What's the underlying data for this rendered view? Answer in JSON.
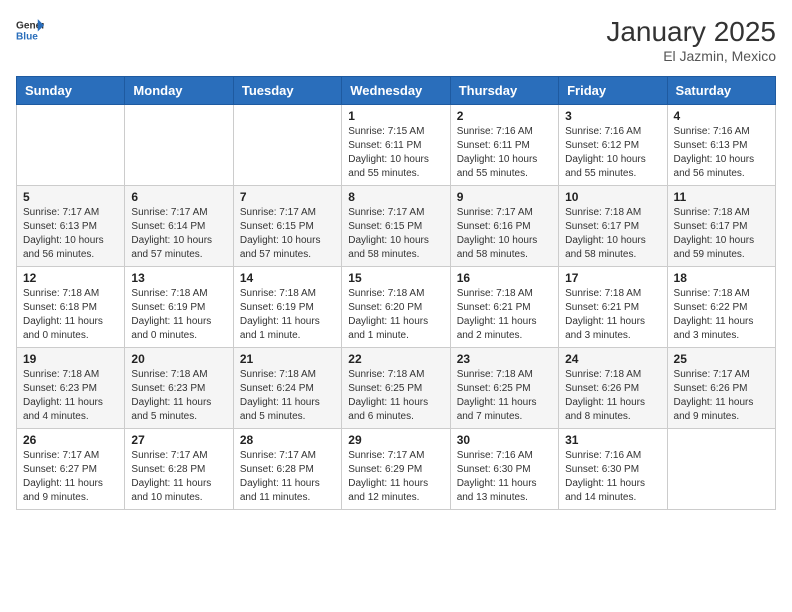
{
  "header": {
    "logo_general": "General",
    "logo_blue": "Blue",
    "month_year": "January 2025",
    "location": "El Jazmin, Mexico"
  },
  "days_of_week": [
    "Sunday",
    "Monday",
    "Tuesday",
    "Wednesday",
    "Thursday",
    "Friday",
    "Saturday"
  ],
  "weeks": [
    [
      {
        "day": "",
        "sunrise": "",
        "sunset": "",
        "daylight": ""
      },
      {
        "day": "",
        "sunrise": "",
        "sunset": "",
        "daylight": ""
      },
      {
        "day": "",
        "sunrise": "",
        "sunset": "",
        "daylight": ""
      },
      {
        "day": "1",
        "sunrise": "7:15 AM",
        "sunset": "6:11 PM",
        "daylight": "10 hours and 55 minutes."
      },
      {
        "day": "2",
        "sunrise": "7:16 AM",
        "sunset": "6:11 PM",
        "daylight": "10 hours and 55 minutes."
      },
      {
        "day": "3",
        "sunrise": "7:16 AM",
        "sunset": "6:12 PM",
        "daylight": "10 hours and 55 minutes."
      },
      {
        "day": "4",
        "sunrise": "7:16 AM",
        "sunset": "6:13 PM",
        "daylight": "10 hours and 56 minutes."
      }
    ],
    [
      {
        "day": "5",
        "sunrise": "7:17 AM",
        "sunset": "6:13 PM",
        "daylight": "10 hours and 56 minutes."
      },
      {
        "day": "6",
        "sunrise": "7:17 AM",
        "sunset": "6:14 PM",
        "daylight": "10 hours and 57 minutes."
      },
      {
        "day": "7",
        "sunrise": "7:17 AM",
        "sunset": "6:15 PM",
        "daylight": "10 hours and 57 minutes."
      },
      {
        "day": "8",
        "sunrise": "7:17 AM",
        "sunset": "6:15 PM",
        "daylight": "10 hours and 58 minutes."
      },
      {
        "day": "9",
        "sunrise": "7:17 AM",
        "sunset": "6:16 PM",
        "daylight": "10 hours and 58 minutes."
      },
      {
        "day": "10",
        "sunrise": "7:18 AM",
        "sunset": "6:17 PM",
        "daylight": "10 hours and 58 minutes."
      },
      {
        "day": "11",
        "sunrise": "7:18 AM",
        "sunset": "6:17 PM",
        "daylight": "10 hours and 59 minutes."
      }
    ],
    [
      {
        "day": "12",
        "sunrise": "7:18 AM",
        "sunset": "6:18 PM",
        "daylight": "11 hours and 0 minutes."
      },
      {
        "day": "13",
        "sunrise": "7:18 AM",
        "sunset": "6:19 PM",
        "daylight": "11 hours and 0 minutes."
      },
      {
        "day": "14",
        "sunrise": "7:18 AM",
        "sunset": "6:19 PM",
        "daylight": "11 hours and 1 minute."
      },
      {
        "day": "15",
        "sunrise": "7:18 AM",
        "sunset": "6:20 PM",
        "daylight": "11 hours and 1 minute."
      },
      {
        "day": "16",
        "sunrise": "7:18 AM",
        "sunset": "6:21 PM",
        "daylight": "11 hours and 2 minutes."
      },
      {
        "day": "17",
        "sunrise": "7:18 AM",
        "sunset": "6:21 PM",
        "daylight": "11 hours and 3 minutes."
      },
      {
        "day": "18",
        "sunrise": "7:18 AM",
        "sunset": "6:22 PM",
        "daylight": "11 hours and 3 minutes."
      }
    ],
    [
      {
        "day": "19",
        "sunrise": "7:18 AM",
        "sunset": "6:23 PM",
        "daylight": "11 hours and 4 minutes."
      },
      {
        "day": "20",
        "sunrise": "7:18 AM",
        "sunset": "6:23 PM",
        "daylight": "11 hours and 5 minutes."
      },
      {
        "day": "21",
        "sunrise": "7:18 AM",
        "sunset": "6:24 PM",
        "daylight": "11 hours and 5 minutes."
      },
      {
        "day": "22",
        "sunrise": "7:18 AM",
        "sunset": "6:25 PM",
        "daylight": "11 hours and 6 minutes."
      },
      {
        "day": "23",
        "sunrise": "7:18 AM",
        "sunset": "6:25 PM",
        "daylight": "11 hours and 7 minutes."
      },
      {
        "day": "24",
        "sunrise": "7:18 AM",
        "sunset": "6:26 PM",
        "daylight": "11 hours and 8 minutes."
      },
      {
        "day": "25",
        "sunrise": "7:17 AM",
        "sunset": "6:26 PM",
        "daylight": "11 hours and 9 minutes."
      }
    ],
    [
      {
        "day": "26",
        "sunrise": "7:17 AM",
        "sunset": "6:27 PM",
        "daylight": "11 hours and 9 minutes."
      },
      {
        "day": "27",
        "sunrise": "7:17 AM",
        "sunset": "6:28 PM",
        "daylight": "11 hours and 10 minutes."
      },
      {
        "day": "28",
        "sunrise": "7:17 AM",
        "sunset": "6:28 PM",
        "daylight": "11 hours and 11 minutes."
      },
      {
        "day": "29",
        "sunrise": "7:17 AM",
        "sunset": "6:29 PM",
        "daylight": "11 hours and 12 minutes."
      },
      {
        "day": "30",
        "sunrise": "7:16 AM",
        "sunset": "6:30 PM",
        "daylight": "11 hours and 13 minutes."
      },
      {
        "day": "31",
        "sunrise": "7:16 AM",
        "sunset": "6:30 PM",
        "daylight": "11 hours and 14 minutes."
      },
      {
        "day": "",
        "sunrise": "",
        "sunset": "",
        "daylight": ""
      }
    ]
  ],
  "labels": {
    "sunrise_prefix": "Sunrise: ",
    "sunset_prefix": "Sunset: ",
    "daylight_prefix": "Daylight: "
  }
}
